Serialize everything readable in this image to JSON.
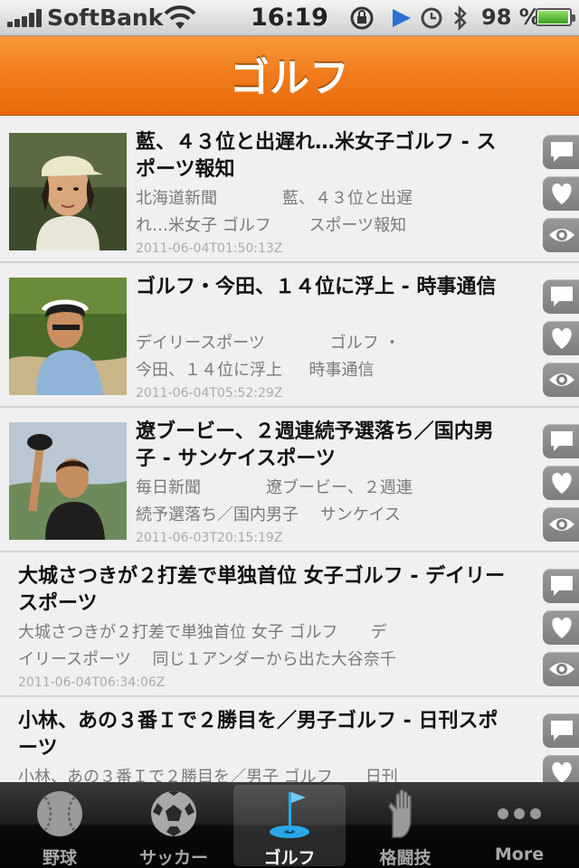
{
  "status_bar": {
    "carrier": "SoftBank",
    "time": "16:19",
    "battery_percent": "98 %",
    "battery_level": 0.98,
    "icons": [
      "signal-icon",
      "wifi-icon",
      "rotation-lock-icon",
      "location-icon",
      "alarm-icon",
      "bluetooth-icon",
      "battery-icon"
    ]
  },
  "nav": {
    "title": "ゴルフ"
  },
  "articles": [
    {
      "title": "藍、４３位と出遅れ…米女子ゴルフ - スポーツ報知",
      "desc_line1": "北海道新聞　　　　藍、４３位と出遅",
      "desc_line2": "れ…米女子 ゴルフ　　 スポーツ報知",
      "date": "2011-06-04T01:50:13Z",
      "thumb": "golfer-cap-photo"
    },
    {
      "title": "ゴルフ・今田、１４位に浮上 - 時事通信",
      "desc_line1": "デイリースポーツ　　　　ゴルフ ・",
      "desc_line2": "今田、１４位に浮上　  時事通信",
      "date": "2011-06-04T05:52:29Z",
      "thumb": "golfer-bunker-photo"
    },
    {
      "title": "遼ブービー、２週連続予選落ち／国内男子 - サンケイスポーツ",
      "desc_line1": "毎日新聞　　　　遼ブービー、２週連",
      "desc_line2": "続予選落ち／国内男子　 サンケイス",
      "date": "2011-06-03T20:15:19Z",
      "thumb": "golfer-waving-photo"
    },
    {
      "title": "大城さつきが２打差で単独首位 女子ゴルフ - デイリースポーツ",
      "desc_line1": "大城さつきが２打差で単独首位 女子 ゴルフ　　デ",
      "desc_line2": "イリースポーツ　 同じ１アンダーから出た大谷奈千",
      "date": "2011-06-04T06:34:06Z",
      "thumb": ""
    },
    {
      "title": "小林、あの３番Ｉで２勝目を／男子ゴルフ - 日刊スポーツ",
      "desc_line1": "小林、あの３番Ｉで２勝目を／男子 ゴルフ　　日刊",
      "desc_line2": "",
      "date": "",
      "thumb": ""
    }
  ],
  "tabs": [
    {
      "label": "野球",
      "icon": "baseball-icon",
      "active": false
    },
    {
      "label": "サッカー",
      "icon": "soccer-ball-icon",
      "active": false
    },
    {
      "label": "ゴルフ",
      "icon": "golf-flag-icon",
      "active": true
    },
    {
      "label": "格闘技",
      "icon": "glove-hand-icon",
      "active": false
    },
    {
      "label": "More",
      "icon": "more-dots-icon",
      "active": false
    }
  ],
  "colors": {
    "nav_orange": "#f07a1a",
    "active_tab_icon": "#2aa7e8",
    "action_gray": "#8a8a8a"
  }
}
